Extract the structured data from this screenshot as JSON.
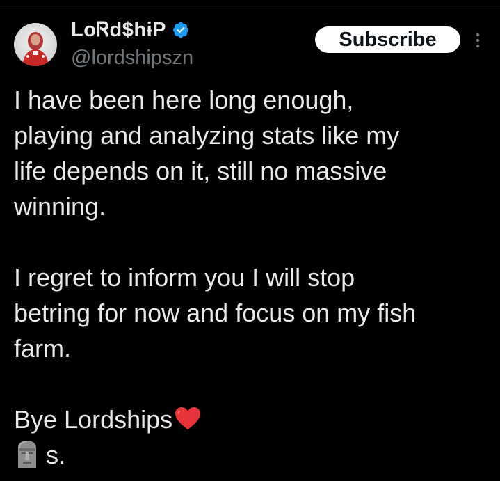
{
  "header": {
    "display_name": "LoᏒd$hɨP",
    "handle": "@lordshipszn",
    "subscribe_label": "Subscribe"
  },
  "icons": {
    "verified": "verified-badge-icon",
    "more": "more-vertical-icon",
    "heart": "red-heart-emoji",
    "moai": "moai-emoji"
  },
  "colors": {
    "background": "#000000",
    "text": "#e7e9ea",
    "secondary_text": "#71767b",
    "verified_blue": "#1d9bf0",
    "button_bg": "#ffffff"
  },
  "tweet": {
    "paragraph_1": "I have been here long enough,\nplaying and analyzing stats like my\nlife depends on it, still no massive\nwinning.",
    "paragraph_2": "I regret to inform you I will stop\nbetring for now and focus on my fish\nfarm.",
    "signoff": "Bye Lordships",
    "final": "s."
  }
}
